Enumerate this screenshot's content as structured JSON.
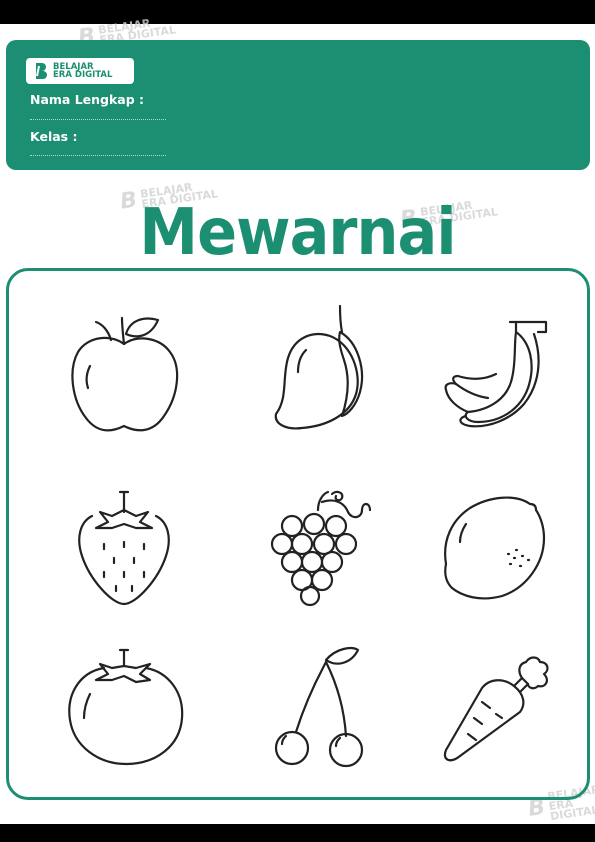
{
  "header": {
    "logo_line1": "BELAJAR",
    "logo_line2": "ERA DIGITAL",
    "name_label": "Nama Lengkap :",
    "class_label": "Kelas :"
  },
  "title": "Mewarnai",
  "watermark": {
    "line1": "BELAJAR",
    "line2": "ERA DIGITAL"
  },
  "colors": {
    "primary": "#1c8f73",
    "outline": "#222222"
  },
  "pictures": [
    "apple-icon",
    "mango-icon",
    "banana-icon",
    "strawberry-icon",
    "grapes-icon",
    "lemon-icon",
    "tomato-icon",
    "cherry-icon",
    "carrot-icon"
  ]
}
